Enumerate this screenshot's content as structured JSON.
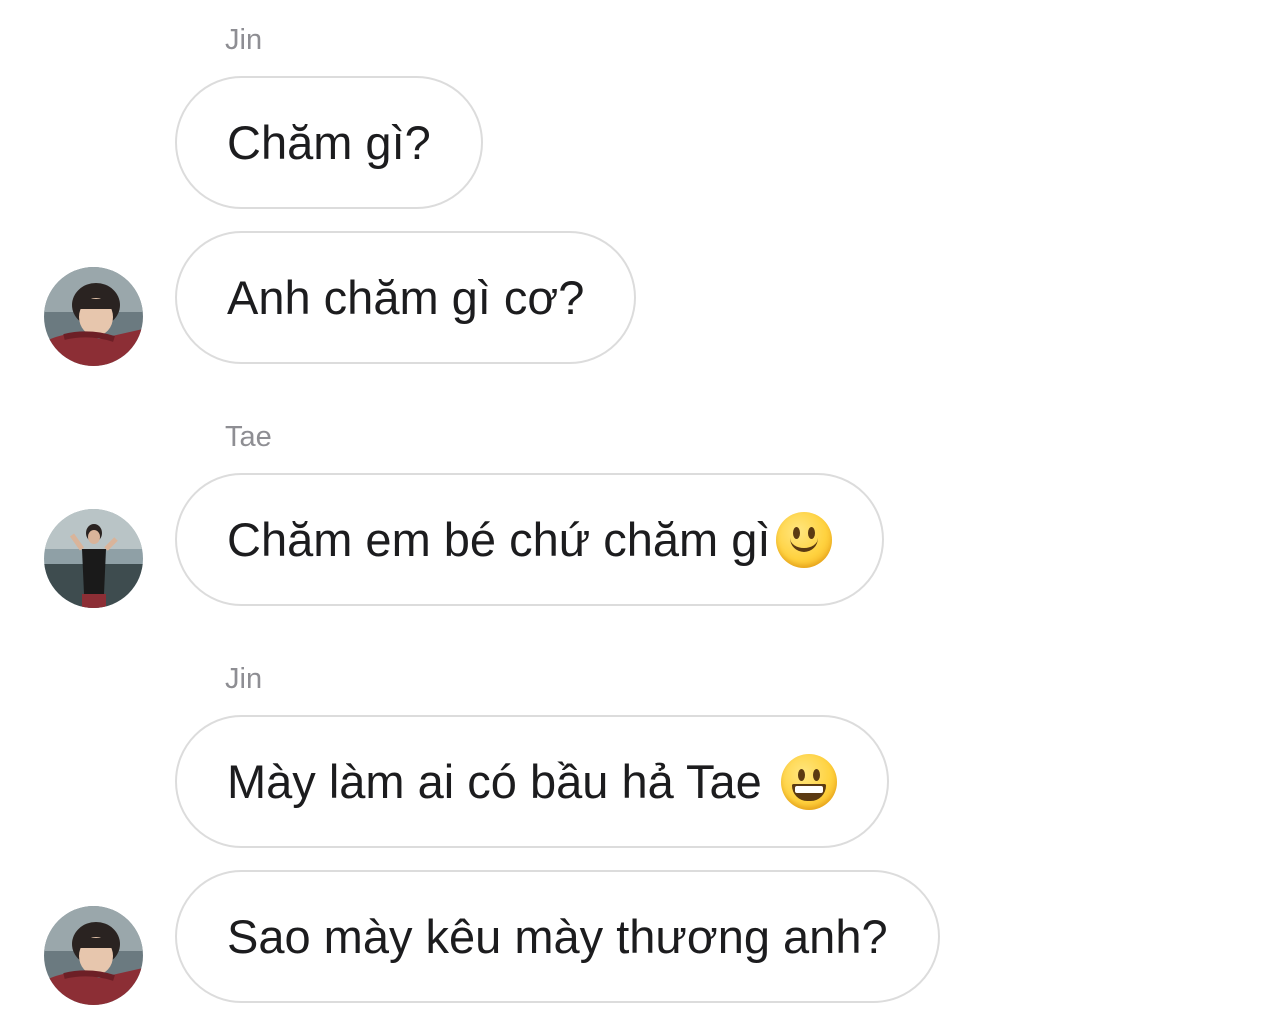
{
  "messages": [
    {
      "sender": "Jin",
      "text": "Chăm gì?"
    },
    {
      "text": "Anh chăm gì cơ?"
    },
    {
      "sender": "Tae",
      "text": "Chăm em bé chứ chăm gì",
      "emoji": "slightly-smiling-face-emoji"
    },
    {
      "sender": "Jin",
      "text": "Mày làm ai có bầu hả Tae ",
      "emoji": "grinning-face-emoji"
    },
    {
      "text": "Sao mày kêu mày thương anh?"
    }
  ],
  "colors": {
    "bubble_border": "#dcdcdc",
    "sender_text": "#8e8e93",
    "message_text": "#1c1c1e",
    "background": "#ffffff"
  }
}
